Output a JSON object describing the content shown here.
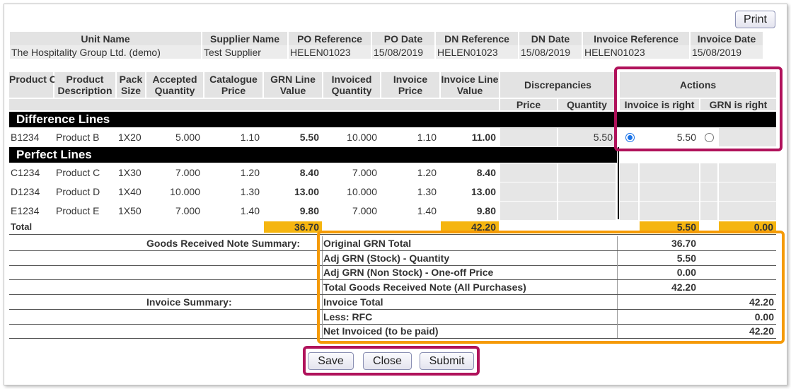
{
  "print_label": "Print",
  "header": {
    "columns": [
      "Unit Name",
      "Supplier Name",
      "PO Reference",
      "PO Date",
      "DN Reference",
      "DN Date",
      "Invoice Reference",
      "Invoice Date"
    ],
    "values": [
      "The Hospitality Group Ltd. (demo)",
      "Test Supplier",
      "HELEN01023",
      "15/08/2019",
      "HELEN01023",
      "15/08/2019",
      "HELEN01023",
      "15/08/2019"
    ]
  },
  "grid": {
    "headers": {
      "product_code": "Product Code",
      "product_description": "Product Description",
      "pack_size": "Pack Size",
      "accepted_quantity": "Accepted Quantity",
      "catalogue_price": "Catalogue Price",
      "grn_line_value": "GRN Line Value",
      "invoiced_quantity": "Invoiced Quantity",
      "invoice_price": "Invoice Price",
      "invoice_line_value": "Invoice Line Value",
      "discrepancies": "Discrepancies",
      "disc_price": "Price",
      "disc_quantity": "Quantity",
      "actions": "Actions",
      "invoice_is_right": "Invoice is right",
      "grn_is_right": "GRN is right"
    },
    "difference_label": "Difference Lines",
    "perfect_label": "Perfect Lines",
    "difference_rows": [
      {
        "code": "B1234",
        "desc": "Product B",
        "pack": "1X20",
        "acc": "5.000",
        "cat": "1.10",
        "grn": "5.50",
        "invq": "10.000",
        "invp": "1.10",
        "invv": "11.00",
        "dprice": "",
        "dqty": "5.50",
        "act_invoice": "5.50",
        "invoice_selected": true
      }
    ],
    "perfect_rows": [
      {
        "code": "C1234",
        "desc": "Product C",
        "pack": "1X30",
        "acc": "7.000",
        "cat": "1.20",
        "grn": "8.40",
        "invq": "7.000",
        "invp": "1.20",
        "invv": "8.40"
      },
      {
        "code": "D1234",
        "desc": "Product D",
        "pack": "1X40",
        "acc": "10.000",
        "cat": "1.30",
        "grn": "13.00",
        "invq": "10.000",
        "invp": "1.30",
        "invv": "13.00"
      },
      {
        "code": "E1234",
        "desc": "Product E",
        "pack": "1X50",
        "acc": "7.000",
        "cat": "1.40",
        "grn": "9.80",
        "invq": "7.000",
        "invp": "1.40",
        "invv": "9.80"
      }
    ],
    "total_label": "Total",
    "totals": {
      "grn": "36.70",
      "invv": "42.20",
      "invoice_right": "5.50",
      "grn_right": "0.00"
    }
  },
  "summary": {
    "grn_heading": "Goods Received Note Summary:",
    "invoice_heading": "Invoice Summary:",
    "rows": [
      {
        "label": "Original GRN Total",
        "grn": "36.70",
        "inv": ""
      },
      {
        "label": "Adj GRN (Stock) - Quantity",
        "grn": "5.50",
        "inv": ""
      },
      {
        "label": "Adj GRN (Non Stock) - One-off Price",
        "grn": "0.00",
        "inv": ""
      },
      {
        "label": "Total Goods Received Note (All Purchases)",
        "grn": "42.20",
        "inv": ""
      },
      {
        "label": "Invoice Total",
        "grn": "",
        "inv": "42.20"
      },
      {
        "label": "Less: RFC",
        "grn": "",
        "inv": "0.00"
      },
      {
        "label": "Net Invoiced (to be paid)",
        "grn": "",
        "inv": "42.20"
      }
    ]
  },
  "buttons": {
    "save": "Save",
    "close": "Close",
    "submit": "Submit"
  },
  "colors": {
    "highlight_red": "#b0125b",
    "highlight_orange": "#f59a06",
    "total_fill": "#f5b50f",
    "band": "#000000"
  }
}
